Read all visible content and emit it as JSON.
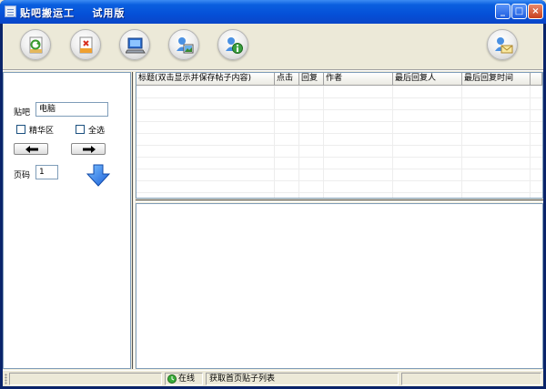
{
  "window": {
    "title": "贴吧搬运工    试用版",
    "controls": [
      "_",
      "□",
      "×"
    ]
  },
  "toolbar": {
    "buttons": [
      {
        "icon": "refresh-document-icon"
      },
      {
        "icon": "delete-document-icon"
      },
      {
        "icon": "computer-icon"
      },
      {
        "icon": "user-picture-icon"
      },
      {
        "icon": "user-info-icon"
      },
      {
        "icon": "user-mail-icon"
      }
    ]
  },
  "left_panel": {
    "tieba_label": "贴吧",
    "tieba_value": "电脑",
    "jinghua_label": "精华区",
    "quanxuan_label": "全选",
    "page_label": "页码",
    "page_value": "1"
  },
  "grid": {
    "columns": [
      "标题(双击显示并保存帖子内容)",
      "点击",
      "回复",
      "作者",
      "最后回复人",
      "最后回复时间",
      ""
    ]
  },
  "status": {
    "online": "在线",
    "message": "获取首页贴子列表"
  }
}
